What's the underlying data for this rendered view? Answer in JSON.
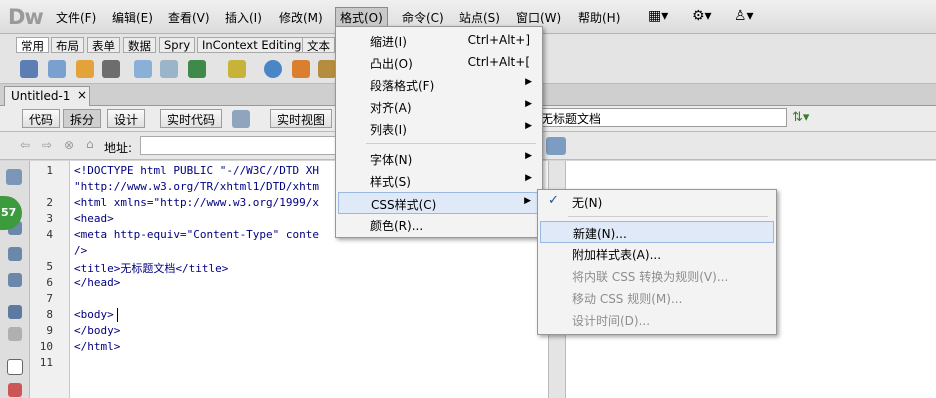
{
  "app": {
    "logo": "Dw"
  },
  "menubar": {
    "items": [
      "文件(F)",
      "编辑(E)",
      "查看(V)",
      "插入(I)",
      "修改(M)",
      "格式(O)",
      "命令(C)",
      "站点(S)",
      "窗口(W)",
      "帮助(H)"
    ]
  },
  "insert_bar": {
    "tabs": [
      "常用",
      "布局",
      "表单",
      "数据",
      "Spry",
      "InContext Editing",
      "文本"
    ]
  },
  "document": {
    "tab": "Untitled-1",
    "close": "×"
  },
  "view_bar": {
    "code": "代码",
    "split": "拆分",
    "design": "设计",
    "live_code": "实时代码",
    "live_view": "实时视图",
    "title_value": "无标题文档"
  },
  "address_bar": {
    "label": "地址:"
  },
  "code": {
    "line_numbers": [
      "1",
      "",
      "2",
      "3",
      "4",
      "",
      "5",
      "6",
      "7",
      "8",
      "9",
      "10",
      "11"
    ],
    "lines": [
      "<!DOCTYPE html PUBLIC \"-//W3C//DTD XH",
      "\"http://www.w3.org/TR/xhtml1/DTD/xhtm",
      "<html xmlns=\"http://www.w3.org/1999/x",
      "<head>",
      "<meta http-equiv=\"Content-Type\" conte",
      "/>",
      "<title>无标题文档</title>",
      "</head>",
      "",
      "<body>",
      "</body>",
      "</html>",
      ""
    ]
  },
  "status_badge": "57",
  "format_menu": {
    "items": [
      {
        "label": "缩进(I)",
        "shortcut": "Ctrl+Alt+]"
      },
      {
        "label": "凸出(O)",
        "shortcut": "Ctrl+Alt+["
      },
      {
        "label": "段落格式(F)"
      },
      {
        "label": "对齐(A)"
      },
      {
        "label": "列表(I)"
      },
      {
        "label": "字体(N)"
      },
      {
        "label": "样式(S)"
      },
      {
        "label": "CSS样式(C)"
      },
      {
        "label": "颜色(R)..."
      }
    ]
  },
  "css_submenu": {
    "check": "✓",
    "items": [
      "无(N)",
      "新建(N)...",
      "附加样式表(A)...",
      "将内联 CSS 转换为规则(V)...",
      "移动 CSS 规则(M)...",
      "设计时间(D)..."
    ]
  }
}
